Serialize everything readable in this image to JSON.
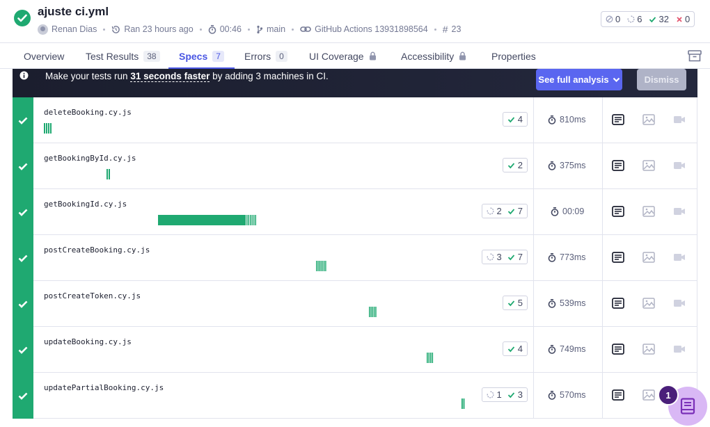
{
  "header": {
    "title": "ajuste ci.yml",
    "author": "Renan Dias",
    "ran": "Ran 23 hours ago",
    "duration": "00:46",
    "branch": "main",
    "ci": "GitHub Actions 13931898564",
    "run_number": "23",
    "counts": {
      "skipped": "0",
      "pending": "6",
      "passed": "32",
      "failed": "0"
    }
  },
  "tabs": [
    {
      "label": "Overview",
      "badge": ""
    },
    {
      "label": "Test Results",
      "badge": "38"
    },
    {
      "label": "Specs",
      "badge": "7",
      "active": true
    },
    {
      "label": "Errors",
      "badge": "0"
    },
    {
      "label": "UI Coverage",
      "badge": "",
      "locked": true
    },
    {
      "label": "Accessibility",
      "badge": "",
      "locked": true
    },
    {
      "label": "Properties",
      "badge": ""
    }
  ],
  "banner": {
    "pre": "Make your tests run ",
    "highlight": "31 seconds faster",
    "post": " by adding 3 machines in CI.",
    "analysis_label": "See full analysis",
    "dismiss_label": "Dismiss"
  },
  "specs": [
    {
      "name": "deleteBooking.cy.js",
      "pending": "",
      "passed": "4",
      "duration": "810ms"
    },
    {
      "name": "getBookingById.cy.js",
      "pending": "",
      "passed": "2",
      "duration": "375ms"
    },
    {
      "name": "getBookingId.cy.js",
      "pending": "2",
      "passed": "7",
      "duration": "00:09"
    },
    {
      "name": "postCreateBooking.cy.js",
      "pending": "3",
      "passed": "7",
      "duration": "773ms"
    },
    {
      "name": "postCreateToken.cy.js",
      "pending": "",
      "passed": "5",
      "duration": "539ms"
    },
    {
      "name": "updateBooking.cy.js",
      "pending": "",
      "passed": "4",
      "duration": "749ms"
    },
    {
      "name": "updatePartialBooking.cy.js",
      "pending": "1",
      "passed": "3",
      "duration": "570ms"
    }
  ],
  "help": {
    "count": "1"
  },
  "colors": {
    "pass": "#1fa971",
    "accent": "#4956e3",
    "banner": "#1b1e2e"
  }
}
